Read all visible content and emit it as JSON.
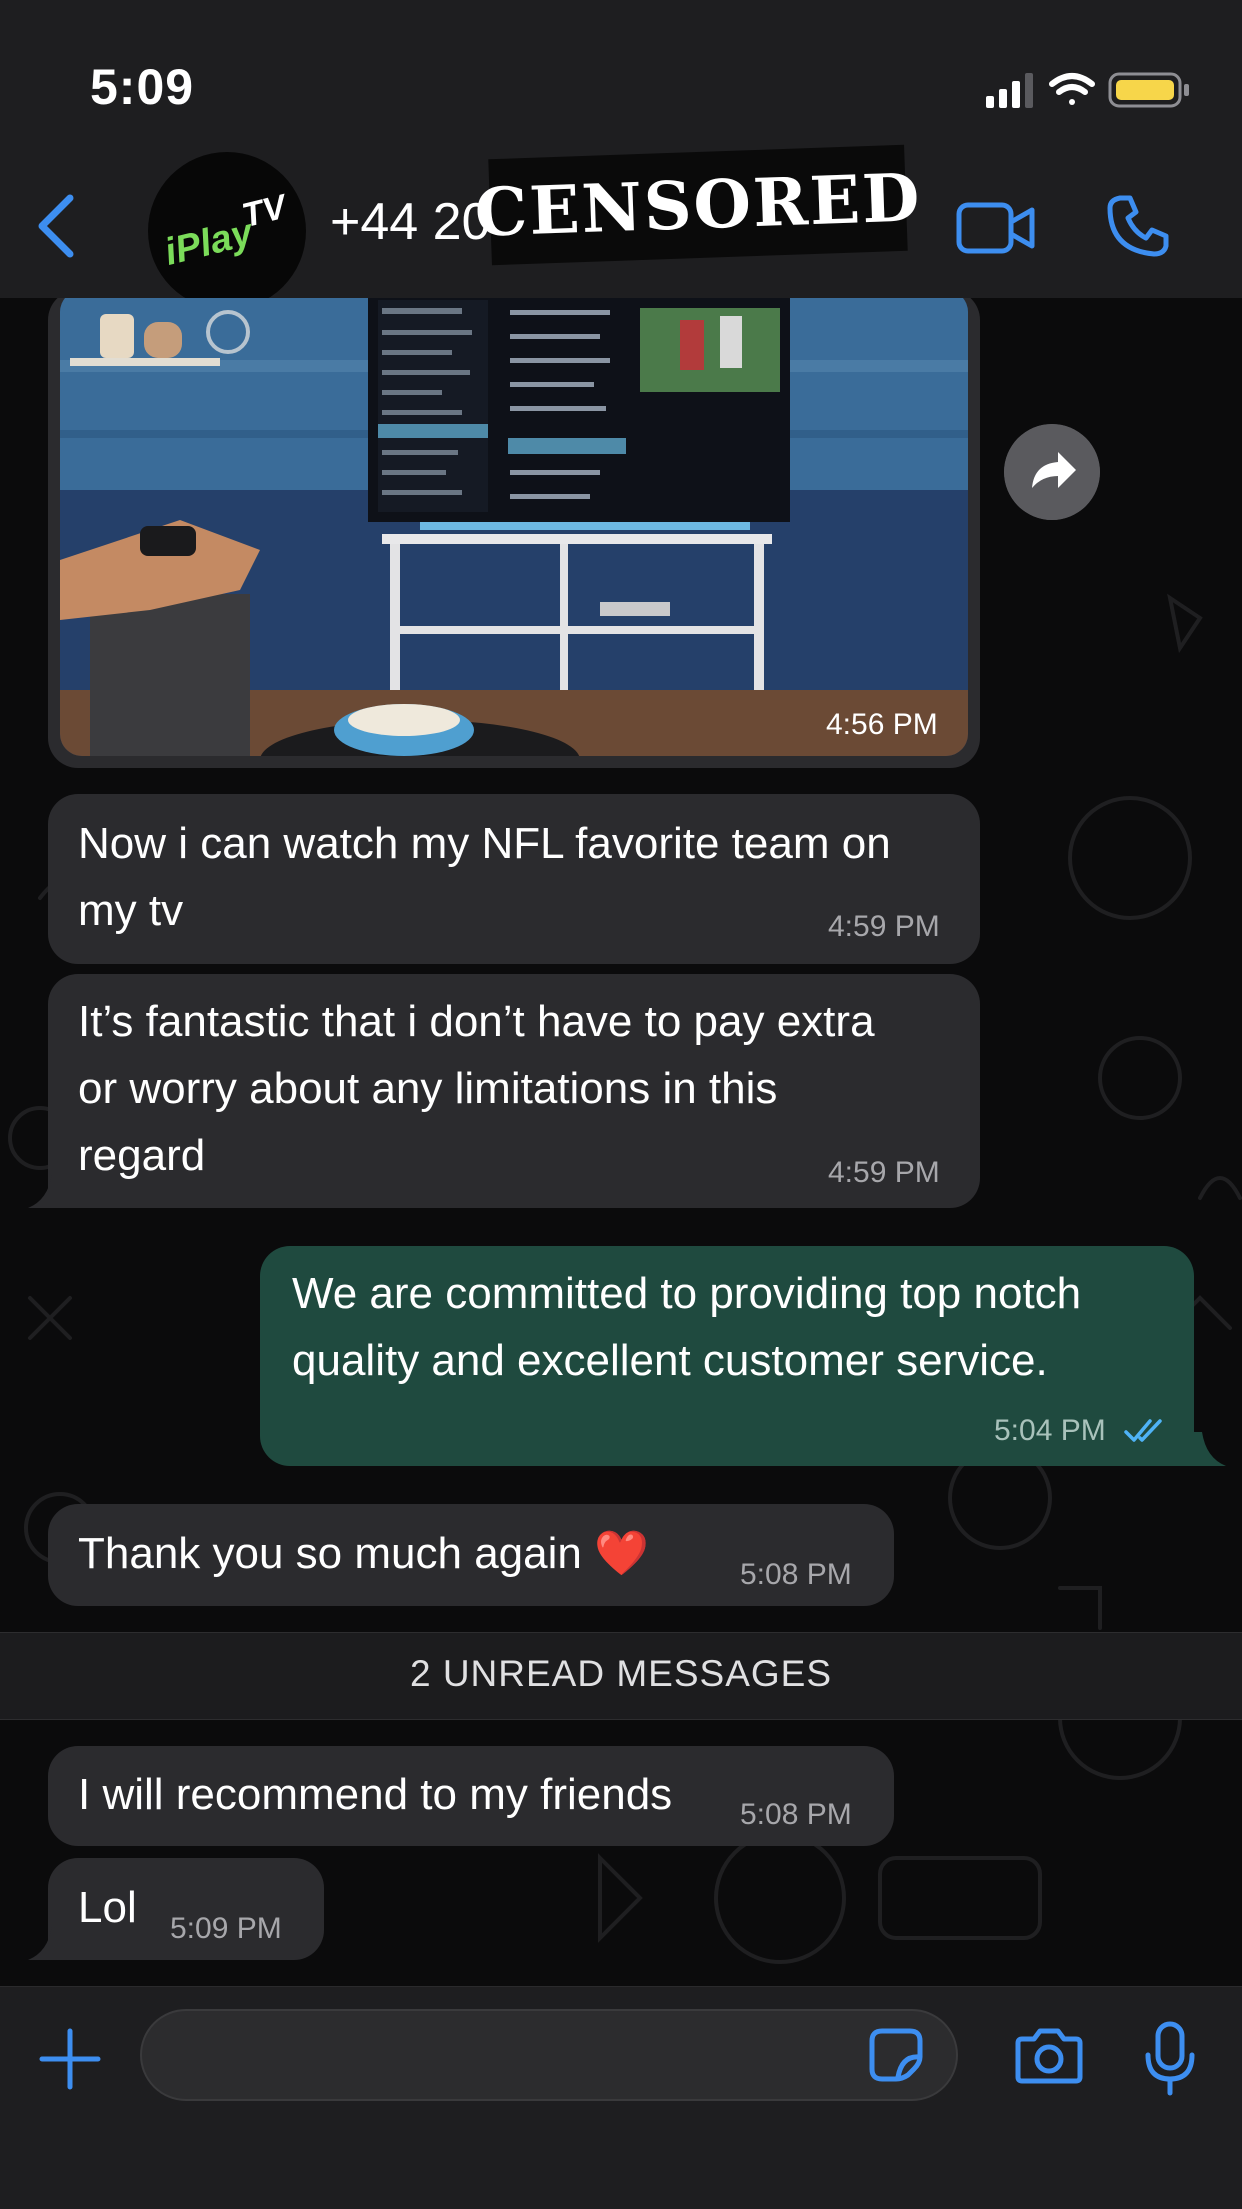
{
  "status_bar": {
    "time": "5:09",
    "battery_color": "#f7d64a"
  },
  "header": {
    "avatar_text": "iPlayTV",
    "contact_name": "+44 20",
    "censor_label": "CENSORED",
    "accent_color": "#3d8ef0",
    "icons": [
      "back-chevron-icon",
      "video-camera-icon",
      "phone-icon"
    ]
  },
  "messages": [
    {
      "type": "media",
      "direction": "incoming",
      "time": "4:56 PM"
    },
    {
      "type": "text",
      "direction": "incoming",
      "lines": [
        "Now i can watch my NFL favorite team on",
        "my tv"
      ],
      "time": "4:59 PM"
    },
    {
      "type": "text",
      "direction": "incoming",
      "lines": [
        "It’s fantastic that i don’t have to pay extra",
        "or worry about any limitations in this",
        "regard"
      ],
      "time": "4:59 PM"
    },
    {
      "type": "text",
      "direction": "outgoing",
      "lines": [
        "We are committed to providing top notch",
        "quality and excellent customer service."
      ],
      "time": "5:04 PM",
      "status": "read"
    },
    {
      "type": "text",
      "direction": "incoming",
      "lines": [
        "Thank you so much again ❤️"
      ],
      "time": "5:08 PM"
    },
    {
      "type": "text",
      "direction": "incoming",
      "lines": [
        "I will recommend to my friends"
      ],
      "time": "5:08 PM"
    },
    {
      "type": "text",
      "direction": "incoming",
      "lines": [
        "Lol"
      ],
      "time": "5:09 PM"
    }
  ],
  "unread_divider": "2 UNREAD MESSAGES",
  "colors": {
    "incoming_bubble": "#2b2b2e",
    "outgoing_bubble": "#1f4a3f",
    "read_ticks": "#4fb3f6"
  },
  "composer": {
    "icons": [
      "plus-icon",
      "sticker-icon",
      "camera-icon",
      "microphone-icon"
    ]
  }
}
